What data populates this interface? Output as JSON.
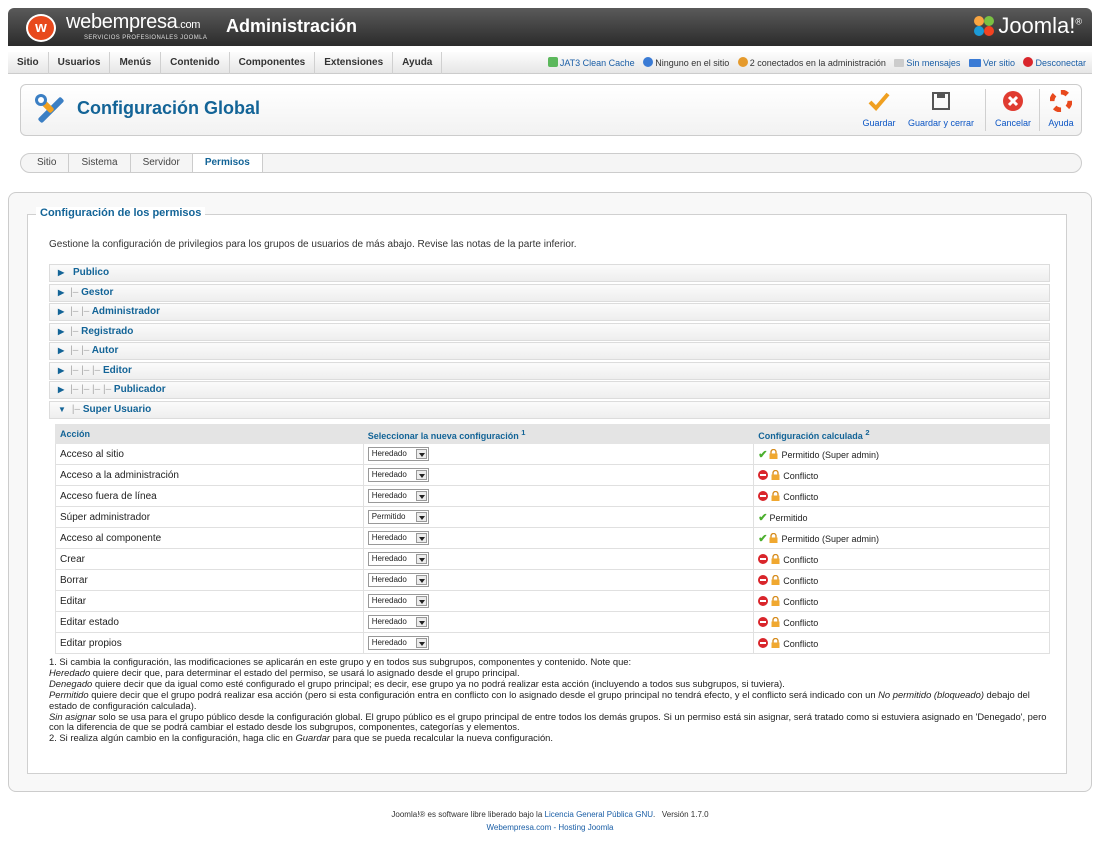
{
  "header": {
    "logo_letter": "w",
    "logo_name": "webempresa",
    "logo_tld": ".com",
    "logo_tagline": "SERVICIOS PROFESIONALES JOOMLA",
    "title": "Administración",
    "joomla_brand": "Joomla!",
    "joomla_mark": "®"
  },
  "menu": {
    "items": [
      "Sitio",
      "Usuarios",
      "Menús",
      "Contenido",
      "Componentes",
      "Extensiones",
      "Ayuda"
    ]
  },
  "status": {
    "cache": "JAT3 Clean Cache",
    "site_users": "Ninguno en el sitio",
    "admin_users": "2 conectados en la administración",
    "messages": "Sin mensajes",
    "view_site": "Ver sitio",
    "logout": "Desconectar"
  },
  "toolbar": {
    "title": "Configuración Global",
    "save": "Guardar",
    "save_close": "Guardar y cerrar",
    "cancel": "Cancelar",
    "help": "Ayuda"
  },
  "tabs": [
    "Sitio",
    "Sistema",
    "Servidor",
    "Permisos"
  ],
  "active_tab": "Permisos",
  "permissions": {
    "legend": "Configuración de los permisos",
    "intro": "Gestione la configuración de privilegios para los grupos de usuarios de más abajo. Revise las notas de la parte inferior.",
    "groups": [
      {
        "indent": "",
        "name": "Publico",
        "expanded": false
      },
      {
        "indent": "|–",
        "name": "Gestor",
        "expanded": false
      },
      {
        "indent": "|– |–",
        "name": "Administrador",
        "expanded": false
      },
      {
        "indent": "|–",
        "name": "Registrado",
        "expanded": false
      },
      {
        "indent": "|– |–",
        "name": "Autor",
        "expanded": false
      },
      {
        "indent": "|– |– |–",
        "name": "Editor",
        "expanded": false
      },
      {
        "indent": "|– |– |– |–",
        "name": "Publicador",
        "expanded": false
      },
      {
        "indent": "|–",
        "name": "Super Usuario",
        "expanded": true
      }
    ],
    "columns": {
      "action": "Acción",
      "select": "Seleccionar la nueva configuración",
      "select_sup": "1",
      "calc": "Configuración calculada",
      "calc_sup": "2"
    },
    "rows": [
      {
        "action": "Acceso al sitio",
        "setting": "Heredado",
        "status": "allowed-admin",
        "calc": "Permitido (Super admin)"
      },
      {
        "action": "Acceso a la administración",
        "setting": "Heredado",
        "status": "conflict",
        "calc": "Conflicto"
      },
      {
        "action": "Acceso fuera de línea",
        "setting": "Heredado",
        "status": "conflict",
        "calc": "Conflicto"
      },
      {
        "action": "Súper administrador",
        "setting": "Permitido",
        "status": "allowed",
        "calc": "Permitido"
      },
      {
        "action": "Acceso al componente",
        "setting": "Heredado",
        "status": "allowed-admin",
        "calc": "Permitido (Super admin)"
      },
      {
        "action": "Crear",
        "setting": "Heredado",
        "status": "conflict",
        "calc": "Conflicto"
      },
      {
        "action": "Borrar",
        "setting": "Heredado",
        "status": "conflict",
        "calc": "Conflicto"
      },
      {
        "action": "Editar",
        "setting": "Heredado",
        "status": "conflict",
        "calc": "Conflicto"
      },
      {
        "action": "Editar estado",
        "setting": "Heredado",
        "status": "conflict",
        "calc": "Conflicto"
      },
      {
        "action": "Editar propios",
        "setting": "Heredado",
        "status": "conflict",
        "calc": "Conflicto"
      }
    ]
  },
  "notes": {
    "n1": "1. Si cambia la configuración, las modificaciones se aplicarán en este grupo y en todos sus subgrupos, componentes y contenido. Note que:",
    "heredado_term": "Heredado",
    "heredado_text": " quiere decir que, para determinar el estado del permiso, se usará lo asignado desde el grupo principal.",
    "denegado_term": "Denegado",
    "denegado_text": " quiere decir que da igual como esté configurado el grupo principal; es decir, ese grupo ya no podrá realizar esta acción (incluyendo a todos sus subgrupos, si tuviera).",
    "permitido_term": "Permitido",
    "permitido_text": " quiere decir que el grupo podrá realizar esa acción (pero si esta configuración entra en conflicto con lo asignado desde el grupo principal no tendrá efecto, y el conflicto será indicado con un ",
    "no_permitido_term": "No permitido (bloqueado)",
    "permitido_tail": " debajo del estado de configuración calculada).",
    "sin_asignar_term": "Sin asignar",
    "sin_asignar_text": " solo se usa para el grupo público desde la configuración global. El grupo público es el grupo principal de entre todos los demás grupos. Si un permiso está sin asignar, será tratado como si estuviera asignado en 'Denegado', pero con la diferencia de que se podrá cambiar el estado desde los subgrupos, componentes, categorías y elementos.",
    "n2_pre": "2. Si realiza algún cambio en la configuración, haga clic en ",
    "n2_term": "Guardar",
    "n2_post": " para que se pueda recalcular la nueva configuración."
  },
  "footer": {
    "pre": "Joomla!® es software libre liberado bajo la ",
    "license": "Licencia General Pública GNU",
    "post": ".   Versión 1.7.0",
    "line2": "Webempresa.com - Hosting Joomla"
  },
  "colors": {
    "accent": "#136497",
    "link": "#1a5ea6",
    "brand_orange": "#e8491d",
    "allowed_green": "#4caf2e",
    "deny_red": "#d9252b"
  }
}
